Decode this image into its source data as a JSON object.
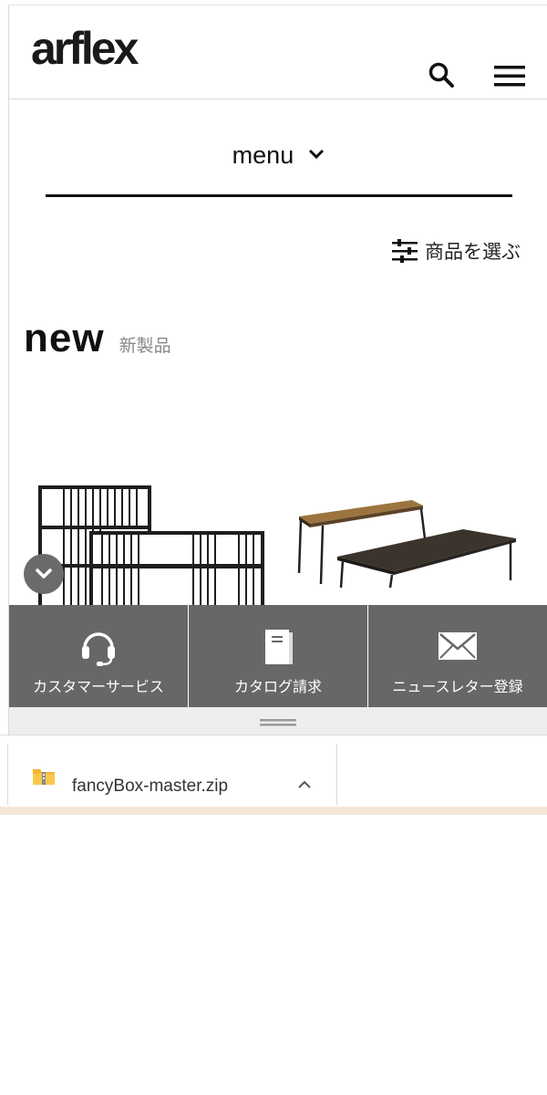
{
  "header": {
    "logo_text": "arflex",
    "search_icon": "search-icon",
    "menu_icon": "hamburger-icon"
  },
  "menu": {
    "label": "menu",
    "icon": "chevron-down-icon"
  },
  "filter": {
    "label": "商品を選ぶ",
    "icon": "sliders-icon"
  },
  "section": {
    "title_en": "new",
    "title_ja": "新製品"
  },
  "products": [
    {
      "name": "shelf-product-image"
    },
    {
      "name": "table-product-image"
    }
  ],
  "scroll_button": {
    "icon": "chevron-down-icon"
  },
  "quick_links": [
    {
      "label": "カスタマーサービス",
      "icon": "headset-icon"
    },
    {
      "label": "カタログ請求",
      "icon": "catalog-icon"
    },
    {
      "label": "ニュースレター登録",
      "icon": "envelope-icon"
    }
  ],
  "download": {
    "filename": "fancyBox-master.zip",
    "icon": "zip-folder-icon",
    "toggle_icon": "chevron-up-icon"
  },
  "colors": {
    "quick_bar_bg": "#676767",
    "accent_text": "#111111",
    "download_strip": "#f4e7da"
  }
}
